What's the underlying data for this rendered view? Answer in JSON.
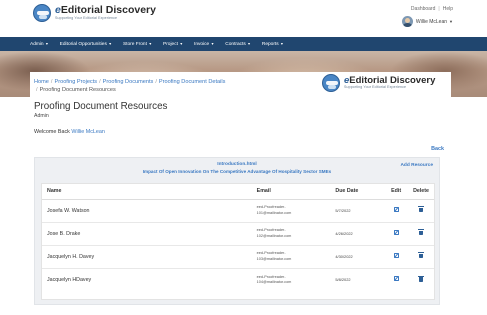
{
  "brand": {
    "name_prefix": "e",
    "name_rest": "Editorial Discovery",
    "tagline": "Supporting Your Editorial Experience"
  },
  "top_links": {
    "dashboard": "Dashboard",
    "separator": "|",
    "help": "Help"
  },
  "user": {
    "name": "Willie McLean"
  },
  "nav": {
    "items": [
      {
        "label": "Admin"
      },
      {
        "label": "Editorial Opportunities"
      },
      {
        "label": "Store Front"
      },
      {
        "label": "Project"
      },
      {
        "label": "Invoice"
      },
      {
        "label": "Contracts"
      },
      {
        "label": "Reports"
      }
    ]
  },
  "breadcrumb": {
    "items": [
      "Home",
      "Proofing Projects",
      "Proofing Documents",
      "Proofing Document Details"
    ],
    "current": "Proofing Document Resources",
    "separator": "/"
  },
  "page": {
    "title": "Proofing Document Resources",
    "role": "Admin",
    "welcome_prefix": "Welcome Back",
    "welcome_name": "Willie McLean",
    "back_label": "Back"
  },
  "document": {
    "file": "Introduction.html",
    "title": "Impact Of Open Innovation On The Competitive Advantage Of Hospitality Sector SMEs",
    "add_resource_label": "Add Resource"
  },
  "table": {
    "columns": [
      "Name",
      "Email",
      "Due Date",
      "Edit",
      "Delete"
    ],
    "rows": [
      {
        "name": "Josefa  W. Watson",
        "email_line1": "eed-Proofreader-",
        "email_line2": "101@mailinator.com",
        "due": "5/7/2022"
      },
      {
        "name": "Jose  B. Drake",
        "email_line1": "eed-Proofreader-",
        "email_line2": "102@mailinator.com",
        "due": "4/26/2022"
      },
      {
        "name": "Jacquelyn  H. Davey",
        "email_line1": "eed-Proofreader-",
        "email_line2": "103@mailinator.com",
        "due": "4/30/2022"
      },
      {
        "name": "Jacquelyn  HDavey",
        "email_line1": "eed-Proofreader-",
        "email_line2": "104@mailinator.com",
        "due": "5/8/2022"
      }
    ]
  },
  "icons": {
    "edit": "edit-icon",
    "delete": "trash-icon",
    "caret": "chevron-down-icon"
  },
  "colors": {
    "nav_bg": "#20466f",
    "link": "#3b79c2",
    "card_bg": "#eef0f3"
  }
}
